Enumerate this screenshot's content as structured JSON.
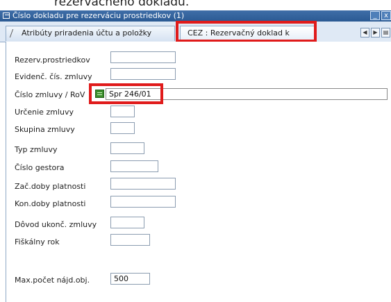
{
  "top_caption": "rezervačného dokladu.",
  "window": {
    "title": "Číslo dokladu pre rezerváciu prostriedkov (1)",
    "title_icon": "dialog-icon",
    "buttons": [
      "minimize-icon",
      "close-icon"
    ],
    "close_glyph": "x"
  },
  "tabs": [
    {
      "label": "Atribúty priradenia účtu a položky",
      "active": false
    },
    {
      "label": "CEZ : Rezervačný doklad k zmluve",
      "active": true
    }
  ],
  "tab_nav": {
    "left_glyph": "◀",
    "right_glyph": "▶"
  },
  "form": {
    "rezerv": {
      "label": "Rezerv.prostriedkov",
      "value": ""
    },
    "evidenc": {
      "label": "Evidenč. čís. zmluvy",
      "value": ""
    },
    "cislo_zmluvy": {
      "label": "Číslo zmluvy / RoV",
      "value": "Spr 246/01"
    },
    "urcenie": {
      "label": "Určenie zmluvy",
      "value": ""
    },
    "skupina": {
      "label": "Skupina zmluvy",
      "value": ""
    },
    "typ": {
      "label": "Typ zmluvy",
      "value": ""
    },
    "gestor": {
      "label": "Číslo gestora",
      "value": ""
    },
    "zac_doby": {
      "label": "Zač.doby platnosti",
      "value": ""
    },
    "kon_doby": {
      "label": "Kon.doby platnosti",
      "value": ""
    },
    "dovod": {
      "label": "Dôvod ukonč. zmluvy",
      "value": ""
    },
    "fiskalny": {
      "label": "Fiškálny rok",
      "value": ""
    },
    "max_pocet": {
      "label": "Max.počet nájd.obj.",
      "value": "500"
    }
  },
  "colors": {
    "highlight": "#e01b1b",
    "title_bar": "#2b5a93",
    "matchcode": "#3a8d2b"
  }
}
